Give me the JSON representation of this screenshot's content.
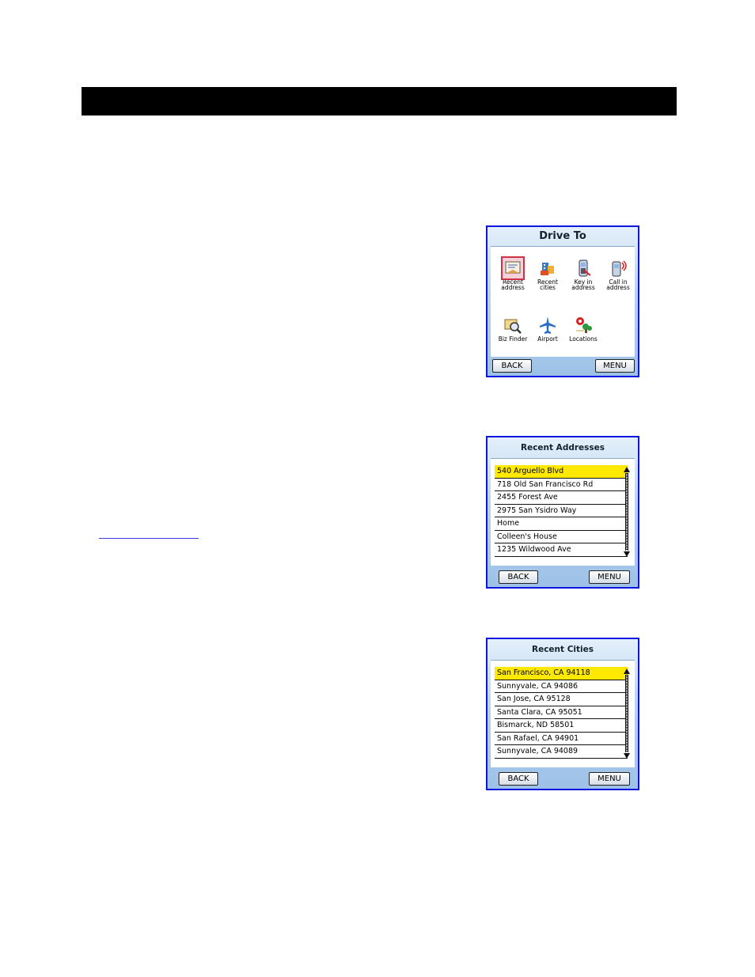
{
  "drive_to": {
    "title": "Drive To",
    "items": [
      {
        "label": "Recent\naddress",
        "icon": "recent-address-icon"
      },
      {
        "label": "Recent\ncities",
        "icon": "recent-cities-icon"
      },
      {
        "label": "Key in\naddress",
        "icon": "key-in-address-icon"
      },
      {
        "label": "Call in\naddress",
        "icon": "call-in-address-icon"
      },
      {
        "label": "Biz Finder",
        "icon": "biz-finder-icon"
      },
      {
        "label": "Airport",
        "icon": "airport-icon"
      },
      {
        "label": "Locations",
        "icon": "locations-icon"
      }
    ],
    "back_label": "BACK",
    "menu_label": "MENU"
  },
  "recent_addresses": {
    "title": "Recent Addresses",
    "rows": [
      "540 Arguello Blvd",
      "718 Old San Francisco Rd",
      "2455 Forest Ave",
      "2975 San Ysidro Way",
      "Home",
      "Colleen's House",
      "1235 Wildwood Ave"
    ],
    "back_label": "BACK",
    "menu_label": "MENU"
  },
  "recent_cities": {
    "title": "Recent Cities",
    "rows": [
      "San Francisco, CA 94118",
      "Sunnyvale, CA 94086",
      "San Jose, CA 95128",
      "Santa Clara, CA 95051",
      "Bismarck, ND 58501",
      "San Rafael, CA 94901",
      "Sunnyvale, CA 94089"
    ],
    "back_label": "BACK",
    "menu_label": "MENU"
  },
  "colors": {
    "header_bar": "#000000",
    "screen_border": "#0c16e0",
    "highlight": "#ffe900"
  }
}
